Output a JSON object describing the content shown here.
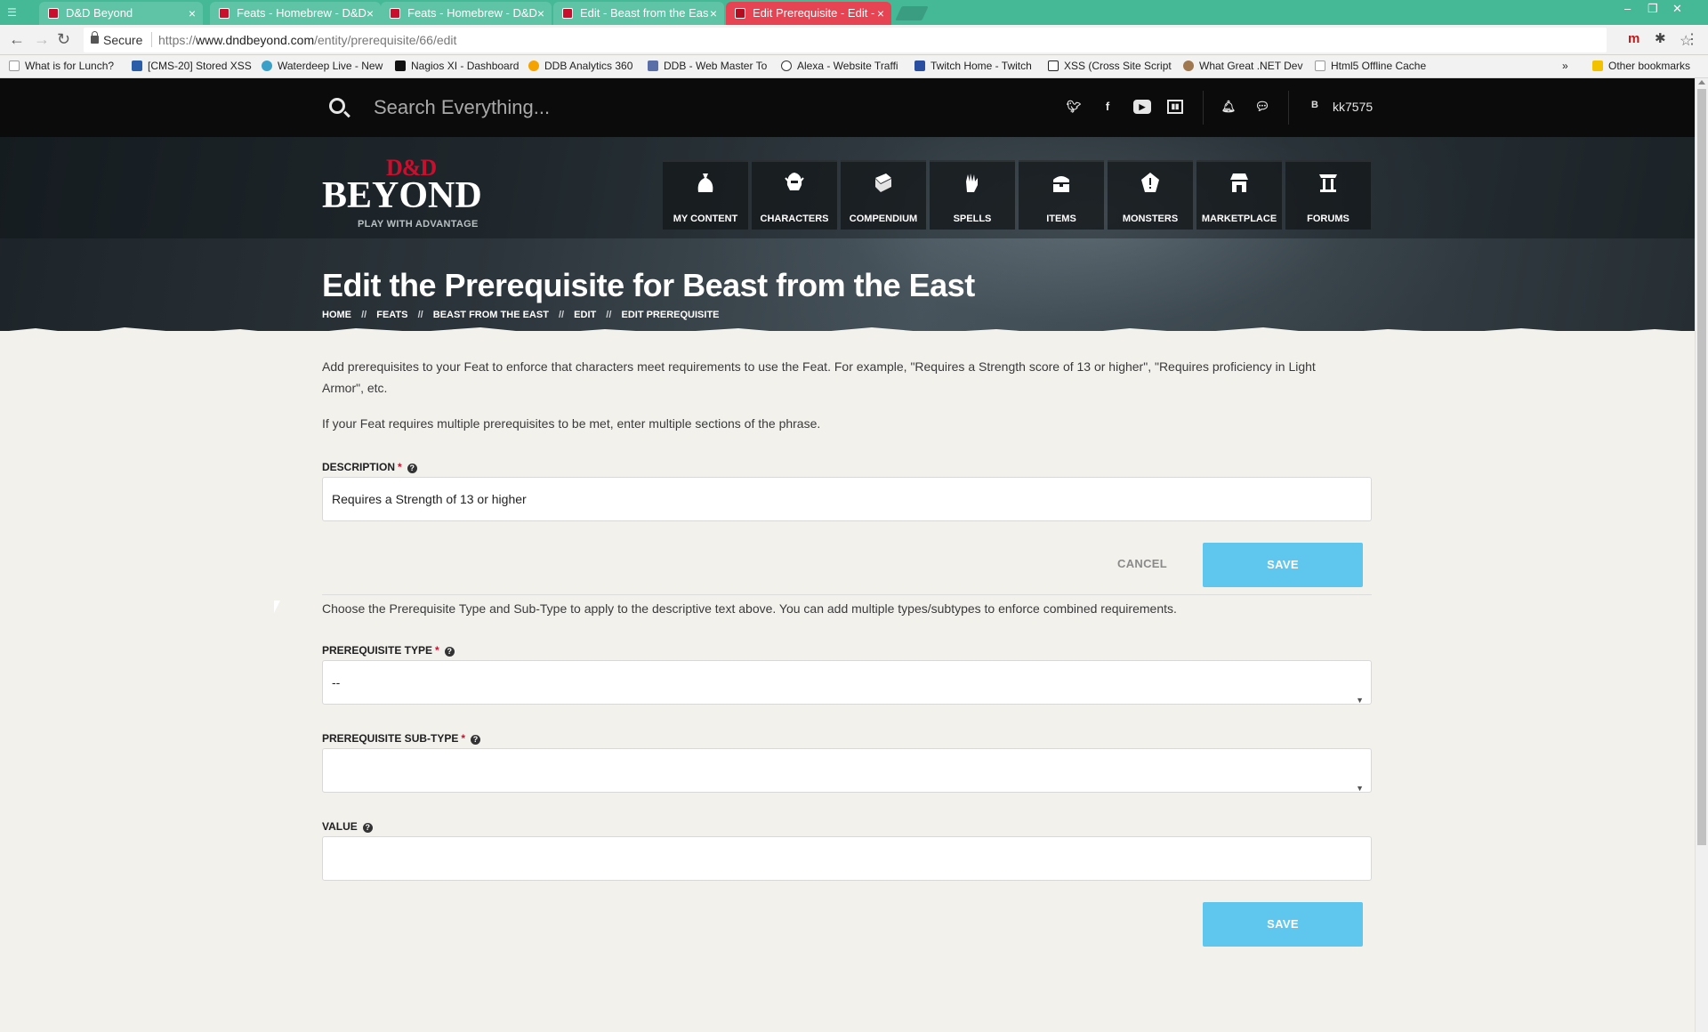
{
  "browser": {
    "tabs": [
      {
        "title": "D&D Beyond",
        "active": false
      },
      {
        "title": "Feats - Homebrew - D&D",
        "active": false
      },
      {
        "title": "Feats - Homebrew - D&D",
        "active": false
      },
      {
        "title": "Edit - Beast from the Eas",
        "active": false
      },
      {
        "title": "Edit Prerequisite - Edit -",
        "active": true
      }
    ],
    "secure_label": "Secure",
    "url_scheme": "https://",
    "url_host": "www.dndbeyond.com",
    "url_path": "/entity/prerequisite/66/edit",
    "bookmarks": [
      {
        "label": "What is for Lunch?",
        "icon": "page-icon"
      },
      {
        "label": "[CMS-20] Stored XSS",
        "icon": "jira-icon"
      },
      {
        "label": "Waterdeep Live - New",
        "icon": "eye-icon"
      },
      {
        "label": "Nagios XI - Dashboard",
        "icon": "nagios-icon"
      },
      {
        "label": "DDB Analytics 360",
        "icon": "analytics-icon"
      },
      {
        "label": "DDB - Web Master To",
        "icon": "webmaster-icon"
      },
      {
        "label": "Alexa - Website Traffi",
        "icon": "alexa-icon"
      },
      {
        "label": "Twitch Home - Twitch",
        "icon": "twitch-icon"
      },
      {
        "label": "XSS (Cross Site Script",
        "icon": "rs-icon"
      },
      {
        "label": "What Great .NET Dev",
        "icon": "person-icon"
      },
      {
        "label": "Html5 Offline Cache",
        "icon": "page-icon"
      }
    ],
    "bookmarks_overflow": "»",
    "other_bookmarks": "Other bookmarks"
  },
  "site": {
    "search_placeholder": "Search Everything...",
    "username": "kk7575",
    "user_badge": "B",
    "logo": {
      "dd": "D&D",
      "main": "BEYOND",
      "tagline": "PLAY WITH ADVANTAGE"
    },
    "menu": [
      {
        "label": "MY CONTENT",
        "icon": "bag-icon"
      },
      {
        "label": "CHARACTERS",
        "icon": "helmet-icon"
      },
      {
        "label": "COMPENDIUM",
        "icon": "book-icon"
      },
      {
        "label": "SPELLS",
        "icon": "hand-icon"
      },
      {
        "label": "ITEMS",
        "icon": "chest-icon"
      },
      {
        "label": "MONSTERS",
        "icon": "monster-icon"
      },
      {
        "label": "MARKETPLACE",
        "icon": "store-icon"
      },
      {
        "label": "FORUMS",
        "icon": "pillar-icon"
      }
    ]
  },
  "page": {
    "title": "Edit the Prerequisite for Beast from the East",
    "breadcrumb": [
      "HOME",
      "FEATS",
      "BEAST FROM THE EAST",
      "EDIT",
      "EDIT PREREQUISITE"
    ],
    "breadcrumb_sep": "//",
    "intro1": "Add prerequisites to your Feat to enforce that characters meet requirements to use the Feat. For example, \"Requires a Strength score of 13 or higher\", \"Requires proficiency in Light Armor\", etc.",
    "intro2": "If your Feat requires multiple prerequisites to be met, enter multiple sections of the phrase.",
    "description_label": "DESCRIPTION",
    "description_value": "Requires a Strength of 13 or higher",
    "cancel_label": "CANCEL",
    "save_label": "SAVE",
    "type_intro": "Choose the Prerequisite Type and Sub-Type to apply to the descriptive text above. You can add multiple types/subtypes to enforce combined requirements.",
    "type_label": "PREREQUISITE TYPE",
    "type_value": "--",
    "subtype_label": "PREREQUISITE SUB-TYPE",
    "subtype_value": "",
    "value_label": "VALUE",
    "value_value": "",
    "required_mark": "*",
    "help_glyph": "?"
  },
  "colors": {
    "tab_strip": "#45b896",
    "active_tab": "#e64452",
    "brand_red": "#c8102e",
    "save_button": "#5fc6ee"
  }
}
